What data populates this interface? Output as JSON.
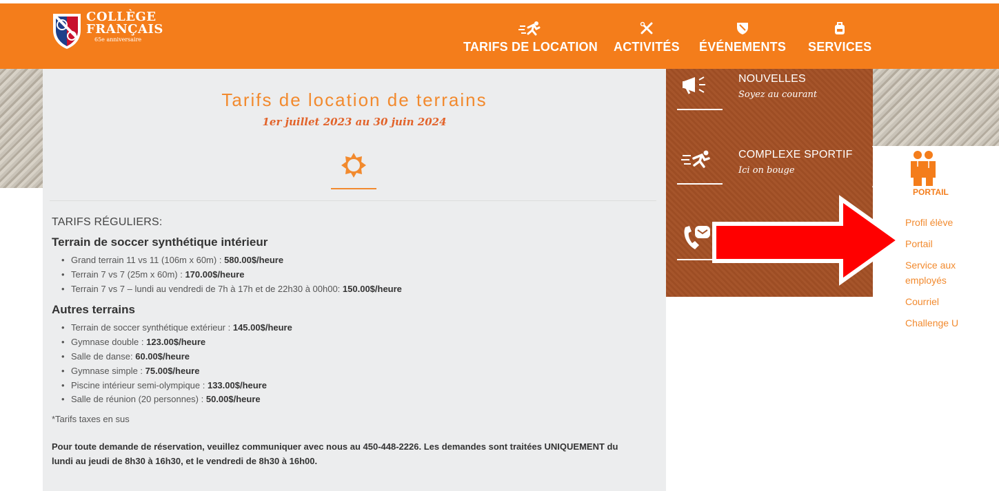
{
  "brand": {
    "line1": "COLLÈGE",
    "line2": "FRANÇAIS",
    "line3": "65e anniversaire"
  },
  "nav": {
    "items": [
      {
        "label": "TARIFS DE LOCATION",
        "icon": "runner-icon"
      },
      {
        "label": "ACTIVITÉS",
        "icon": "tools-icon"
      },
      {
        "label": "ÉVÉNEMENTS",
        "icon": "shield-icon"
      },
      {
        "label": "SERVICES",
        "icon": "backpack-icon"
      }
    ]
  },
  "page": {
    "title": "Tarifs de location de terrains",
    "date_range": "1er juillet 2023 au 30 juin 2024"
  },
  "rates": {
    "regular_heading": "TARIFS RÉGULIERS:",
    "groups": [
      {
        "title": "Terrain de soccer synthétique intérieur",
        "items": [
          {
            "desc": "Grand terrain 11 vs 11 (106m x 60m) : ",
            "price": "580.00$/heure"
          },
          {
            "desc": "Terrain 7 vs 7 (25m x 60m) : ",
            "price": "170.00$/heure"
          },
          {
            "desc": "Terrain 7 vs 7 – lundi au vendredi de 7h à 17h et de 22h30 à 00h00: ",
            "price": "150.00$/heure"
          }
        ]
      },
      {
        "title": "Autres terrains",
        "items": [
          {
            "desc": "Terrain de soccer synthétique extérieur : ",
            "price": "145.00$/heure"
          },
          {
            "desc": "Gymnase double : ",
            "price": "123.00$/heure"
          },
          {
            "desc": "Salle de danse: ",
            "price": "60.00$/heure"
          },
          {
            "desc": "Gymnase simple : ",
            "price": "75.00$/heure"
          },
          {
            "desc": "Piscine intérieur semi-olympique : ",
            "price": "133.00$/heure"
          },
          {
            "desc": "Salle de réunion (20 personnes) : ",
            "price": "50.00$/heure"
          }
        ]
      }
    ],
    "taxes_note": "*Tarifs taxes en sus",
    "contact_note": "Pour toute demande de réservation, veuillez communiquer avec nous au 450-448-2226. Les demandes sont traitées UNIQUEMENT du lundi au jeudi de 8h30 à 16h30, et le vendredi de 8h30 à 16h00."
  },
  "side_panel": {
    "items": [
      {
        "title": "NOUVELLES",
        "subtitle": "Soyez au courant",
        "icon": "megaphone-icon"
      },
      {
        "title": "COMPLEXE SPORTIF",
        "subtitle": "Ici on bouge",
        "icon": "runner-icon"
      },
      {
        "title": "",
        "subtitle": "",
        "icon": "phone-mail-icon"
      }
    ]
  },
  "portal": {
    "label": "PORTAIL",
    "links": [
      "Profil élève",
      "Portail",
      "Service aux employés",
      "Courriel",
      "Challenge U"
    ]
  },
  "colors": {
    "header_orange": "#f47d1b",
    "title_orange": "#f28a2e",
    "panel_brown": "#a6552b",
    "arrow_red": "#ff0000"
  }
}
